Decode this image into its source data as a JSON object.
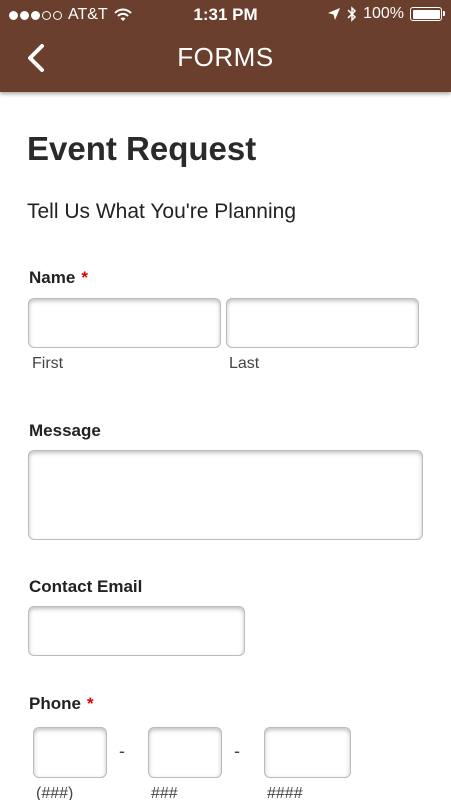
{
  "status_bar": {
    "carrier": "AT&T",
    "time": "1:31 PM",
    "battery": "100%"
  },
  "nav": {
    "title": "FORMS"
  },
  "form": {
    "title": "Event Request",
    "subtitle": "Tell Us What You're Planning",
    "name": {
      "label": "Name",
      "required_mark": "*",
      "first_hint": "First",
      "last_hint": "Last",
      "first_value": "",
      "last_value": ""
    },
    "message": {
      "label": "Message",
      "value": ""
    },
    "email": {
      "label": "Contact Email",
      "value": ""
    },
    "phone": {
      "label": "Phone",
      "required_mark": "*",
      "separator": "-",
      "area_hint": "(###)",
      "prefix_hint": "###",
      "line_hint": "####"
    }
  }
}
